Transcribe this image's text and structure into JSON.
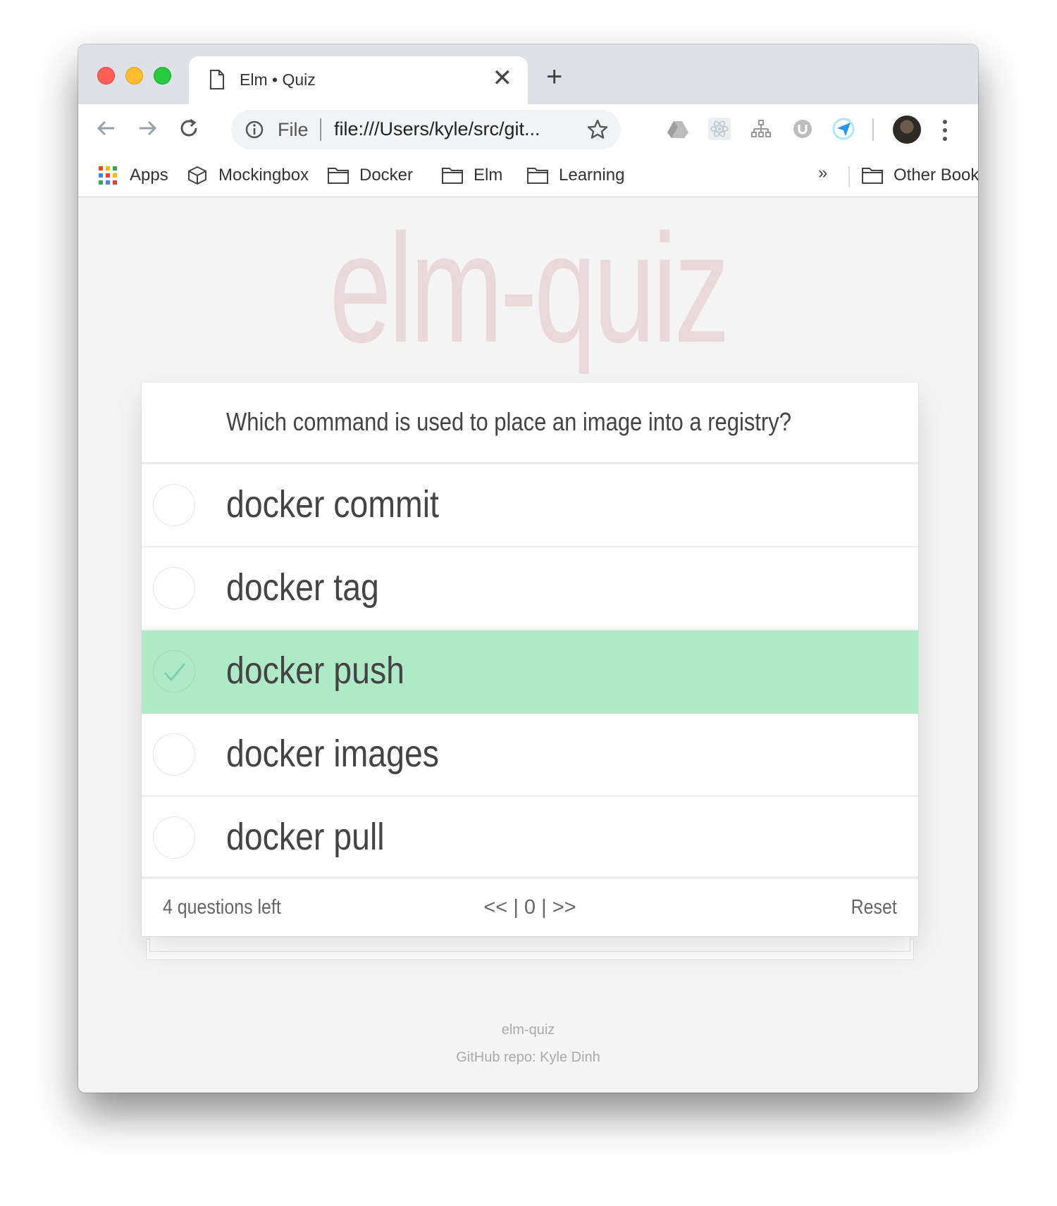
{
  "browser": {
    "tab_title": "Elm • Quiz",
    "tab_close": "✕",
    "new_tab": "+",
    "omnibox": {
      "scheme_label": "File",
      "url": "file:///Users/kyle/src/git..."
    },
    "icons": [
      "back-arrow-icon",
      "forward-arrow-icon",
      "reload-icon",
      "info-icon",
      "star-icon",
      "google-drive-icon",
      "react-devtools-icon",
      "sitemap-icon",
      "extension-u-icon",
      "send-icon",
      "avatar",
      "menu-dots-icon"
    ]
  },
  "bookmarks": {
    "items": [
      {
        "label": "Apps",
        "icon": "apps-grid-icon"
      },
      {
        "label": "Mockingbox",
        "icon": "cube-icon"
      },
      {
        "label": "Docker",
        "icon": "folder-icon"
      },
      {
        "label": "Elm",
        "icon": "folder-icon"
      },
      {
        "label": "Learning",
        "icon": "folder-icon"
      }
    ],
    "overflow": "»",
    "other": "Other Bookmarks"
  },
  "page": {
    "hero_title": "elm-quiz",
    "question": "Which command is used to place an image into a registry?",
    "options": [
      {
        "label": "docker commit",
        "selected": false
      },
      {
        "label": "docker tag",
        "selected": false
      },
      {
        "label": "docker push",
        "selected": true
      },
      {
        "label": "docker images",
        "selected": false
      },
      {
        "label": "docker pull",
        "selected": false
      }
    ],
    "footer_bar": {
      "questions_left": "4 questions left",
      "pager_prev": "<<",
      "pager_sep1": "|",
      "pager_current": "0",
      "pager_sep2": "|",
      "pager_next": ">>",
      "reset": "Reset"
    },
    "footer": {
      "title": "elm-quiz",
      "repo": "GitHub repo: Kyle Dinh"
    }
  },
  "colors": {
    "selected_option_bg": "#aeeac7",
    "hero_title": "#ead9da",
    "check": "#7cd0b8"
  }
}
